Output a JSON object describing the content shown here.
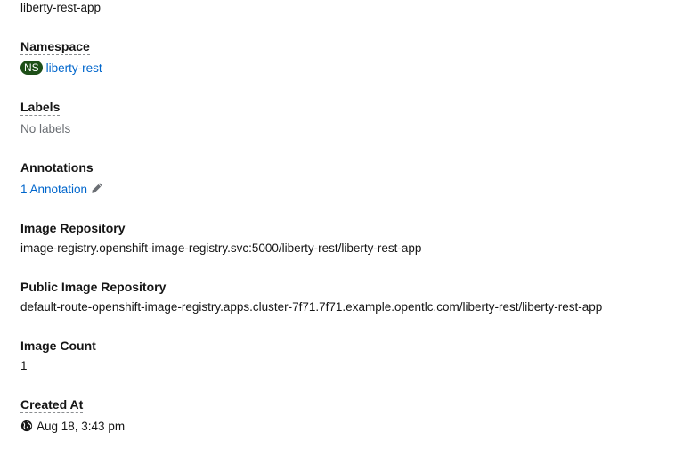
{
  "name_value": "liberty-rest-app",
  "namespace": {
    "label": "Namespace",
    "badge": "NS",
    "value": "liberty-rest"
  },
  "labels": {
    "label": "Labels",
    "value": "No labels"
  },
  "annotations": {
    "label": "Annotations",
    "value": "1 Annotation",
    "edit_icon": "pencil-icon"
  },
  "image_repository": {
    "label": "Image Repository",
    "value": "image-registry.openshift-image-registry.svc:5000/liberty-rest/liberty-rest-app"
  },
  "public_image_repository": {
    "label": "Public Image Repository",
    "value": "default-route-openshift-image-registry.apps.cluster-7f71.7f71.example.opentlc.com/liberty-rest/liberty-rest-app"
  },
  "image_count": {
    "label": "Image Count",
    "value": "1"
  },
  "created_at": {
    "label": "Created At",
    "value": "Aug 18, 3:43 pm",
    "icon": "globe-icon"
  },
  "colors": {
    "link": "#0066cc",
    "badge_bg": "#1e4f18",
    "text": "#151515",
    "muted": "#6a6e73"
  }
}
